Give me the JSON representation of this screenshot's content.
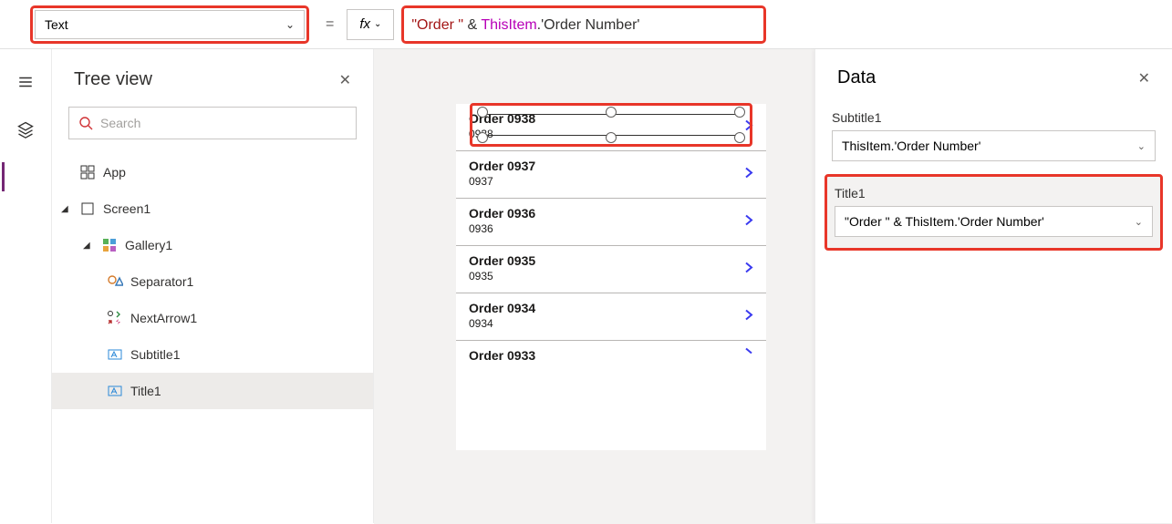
{
  "formula": {
    "prop_name": "Text",
    "fx_label": "fx",
    "equals": "=",
    "expr_str": "\"Order \"",
    "expr_amp": " & ",
    "expr_obj": "ThisItem",
    "expr_dot": ".",
    "expr_member": "'Order Number'"
  },
  "tree": {
    "title": "Tree view",
    "search_placeholder": "Search",
    "items": [
      {
        "label": "App"
      },
      {
        "label": "Screen1"
      },
      {
        "label": "Gallery1"
      },
      {
        "label": "Separator1"
      },
      {
        "label": "NextArrow1"
      },
      {
        "label": "Subtitle1"
      },
      {
        "label": "Title1"
      }
    ]
  },
  "gallery": [
    {
      "title": "Order 0938",
      "sub": "0938"
    },
    {
      "title": "Order 0937",
      "sub": "0937"
    },
    {
      "title": "Order 0936",
      "sub": "0936"
    },
    {
      "title": "Order 0935",
      "sub": "0935"
    },
    {
      "title": "Order 0934",
      "sub": "0934"
    },
    {
      "title": "Order 0933",
      "sub": ""
    }
  ],
  "data_panel": {
    "title": "Data",
    "field1_label": "Subtitle1",
    "field1_value": "ThisItem.'Order Number'",
    "field2_label": "Title1",
    "field2_value": "\"Order \" & ThisItem.'Order Number'"
  }
}
